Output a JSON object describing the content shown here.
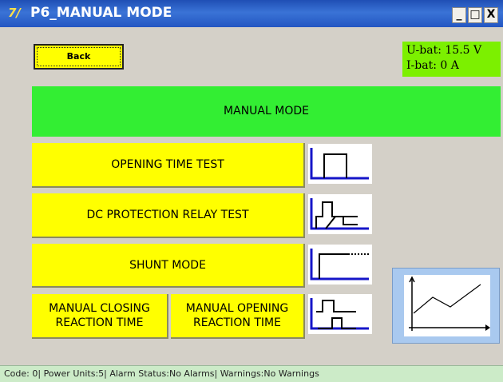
{
  "window": {
    "app_icon": "7/",
    "title": "P6_MANUAL MODE",
    "controls": {
      "minimize": "_",
      "maximize": "□",
      "close": "X"
    }
  },
  "battery": {
    "voltage": "U-bat: 15.5 V",
    "current": "I-bat: 0 A"
  },
  "back_label": "Back",
  "banner_label": "MANUAL MODE",
  "buttons": {
    "opening_time": "OPENING TIME TEST",
    "dc_protection": "DC PROTECTION RELAY TEST",
    "shunt": "SHUNT MODE",
    "manual_closing": "MANUAL CLOSING\nREACTION TIME",
    "manual_opening": "MANUAL OPENING\nREACTION TIME"
  },
  "icons": {
    "opening_time": "pulse-waveform-icon",
    "dc_protection": "relay-step-waveform-icon",
    "shunt": "shunt-step-waveform-icon",
    "reaction": "reaction-waveform-icon",
    "graph": "graph-chart-icon"
  },
  "status_bar": "Code: 0| Power Units:5| Alarm Status:No Alarms| Warnings:No Warnings",
  "colors": {
    "button": "#ffff00",
    "banner": "#33ee33",
    "battery": "#7cf000",
    "wave": "#1515c8"
  }
}
